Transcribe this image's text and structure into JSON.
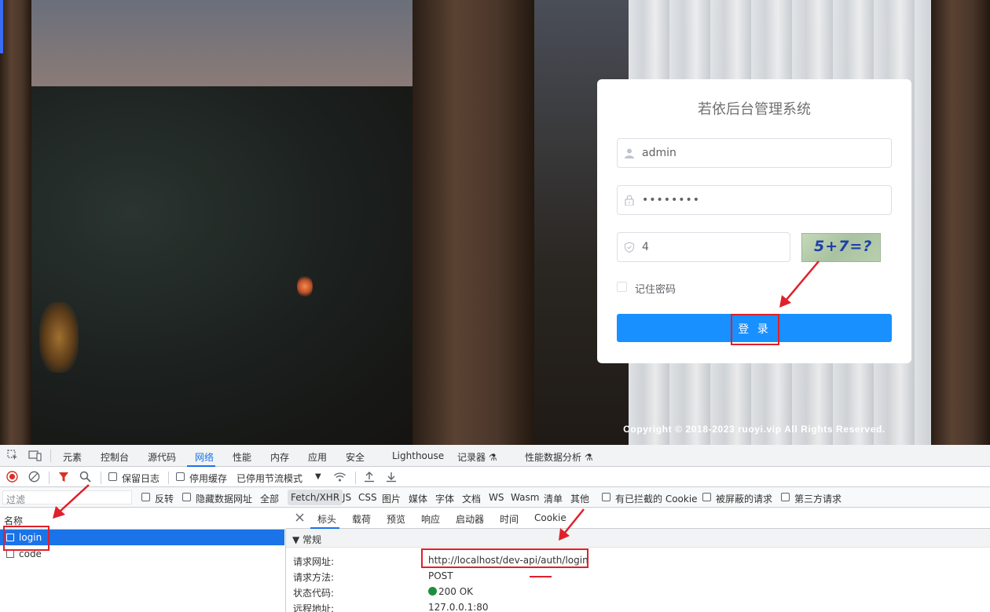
{
  "login": {
    "title": "若依后台管理系统",
    "username": "admin",
    "password_mask": "••••••••",
    "code_value": "4",
    "captcha_text": "5+7=?",
    "remember_label": "记住密码",
    "login_button": "登 录",
    "copyright": "Copyright © 2018-2023 ruoyi.vip All Rights Reserved."
  },
  "devtools": {
    "main_tabs": [
      "元素",
      "控制台",
      "源代码",
      "网络",
      "性能",
      "内存",
      "应用",
      "安全",
      "Lighthouse",
      "记录器 ⚗",
      "性能数据分析 ⚗"
    ],
    "active_tab": "网络",
    "toolbar": {
      "preserve_log": "保留日志",
      "disable_cache": "停用缓存",
      "throttling": "已停用节流模式"
    },
    "filter_bar": {
      "placeholder": "过滤",
      "invert": "反转",
      "hide_data_urls": "隐藏数据网址",
      "types": [
        "全部",
        "Fetch/XHR",
        "JS",
        "CSS",
        "图片",
        "媒体",
        "字体",
        "文档",
        "WS",
        "Wasm",
        "清单",
        "其他"
      ],
      "selected_type": "Fetch/XHR",
      "blocked_cookies": "有已拦截的 Cookie",
      "blocked_requests": "被屏蔽的请求",
      "third_party": "第三方请求"
    },
    "request_list": {
      "header": "名称",
      "items": [
        "login",
        "code"
      ],
      "selected": "login"
    },
    "detail_tabs": [
      "标头",
      "载荷",
      "预览",
      "响应",
      "启动器",
      "时间",
      "Cookie"
    ],
    "active_detail_tab": "标头",
    "general": {
      "section_label": "▼ 常规",
      "rows": [
        {
          "key": "请求网址:",
          "value": "http://localhost/dev-api/auth/login"
        },
        {
          "key": "请求方法:",
          "value": "POST"
        },
        {
          "key": "状态代码:",
          "value": "200 OK"
        },
        {
          "key": "远程地址:",
          "value": "127.0.0.1:80"
        }
      ],
      "status_color": "#1e8e3e"
    }
  },
  "colors": {
    "primary_button": "#1890ff",
    "annotation_red": "#e0202a",
    "devtools_accent": "#1a73e8"
  }
}
